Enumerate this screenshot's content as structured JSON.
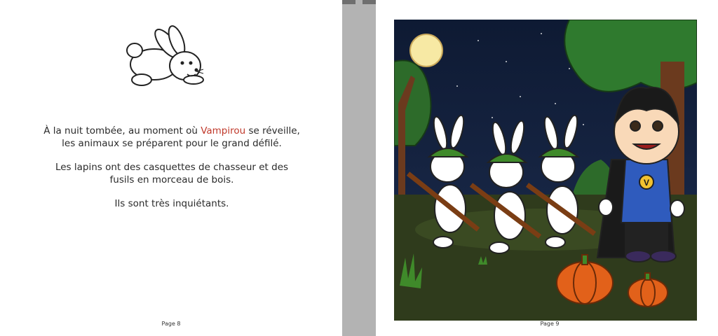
{
  "left_page": {
    "paragraphs": [
      {
        "before": "À la nuit tombée, au moment où ",
        "highlight": "Vampirou",
        "after": " se réveille, les animaux se préparent pour le grand défilé."
      },
      {
        "text": "Les lapins ont des casquettes de chasseur et des fusils en morceau de bois."
      },
      {
        "text": "Ils sont très inquiétants."
      }
    ],
    "page_number": "Page 8",
    "icon": "rabbit-icon"
  },
  "right_page": {
    "page_number": "Page 9",
    "illustration": "vampire-and-rabbits-illustration",
    "badge_letter": "V"
  },
  "colors": {
    "accent": "#c0392b",
    "sky": "#13213f",
    "ground": "#2f3b1c",
    "pumpkin": "#e2611a",
    "hat": "#3f8a2a",
    "cape_vest": "#2f5bbd"
  }
}
